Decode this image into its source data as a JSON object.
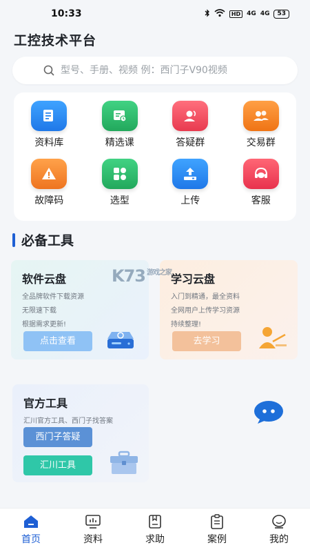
{
  "status_bar": {
    "time": "10:33",
    "hd": "HD",
    "signal1": "4G",
    "signal2": "4G",
    "battery": "53"
  },
  "app": {
    "title": "工控技术平台"
  },
  "search": {
    "placeholder": "型号、手册、视频 例：西门子V90视频"
  },
  "quick_grid": [
    {
      "label": "资料库",
      "icon": "document-library-icon",
      "color": "#2f8cf0"
    },
    {
      "label": "精选课",
      "icon": "course-board-icon",
      "color": "#2dbd6e"
    },
    {
      "label": "答疑群",
      "icon": "qa-group-icon",
      "color": "#f25364"
    },
    {
      "label": "交易群",
      "icon": "trade-group-icon",
      "color": "#f58a26"
    },
    {
      "label": "故障码",
      "icon": "warning-triangle-icon",
      "color": "#f5862a"
    },
    {
      "label": "选型",
      "icon": "selection-grid-icon",
      "color": "#2dbd6e"
    },
    {
      "label": "上传",
      "icon": "upload-icon",
      "color": "#1f8ef0"
    },
    {
      "label": "客服",
      "icon": "customer-service-icon",
      "color": "#f0465c"
    }
  ],
  "section": {
    "title": "必备工具"
  },
  "cards": {
    "software": {
      "title": "软件云盘",
      "lines": [
        "全品牌软件下载资源",
        "无限速下载",
        "根据需求更新!"
      ],
      "button": "点击查看"
    },
    "study": {
      "title": "学习云盘",
      "lines": [
        "入门到精通，最全资料",
        "全网用户上传学习资源",
        "持续整理!"
      ],
      "button": "去学习"
    },
    "official": {
      "title": "官方工具",
      "subtitle": "汇川官方工具、西门子找答案",
      "button1": "西门子答疑",
      "button2": "汇川工具"
    }
  },
  "watermark": {
    "text": "K73",
    "sub": "游戏之家"
  },
  "tabs": [
    {
      "label": "首页",
      "active": true
    },
    {
      "label": "资料",
      "active": false
    },
    {
      "label": "求助",
      "active": false
    },
    {
      "label": "案例",
      "active": false
    },
    {
      "label": "我的",
      "active": false
    }
  ],
  "colors": {
    "accent": "#1e5fd4"
  }
}
